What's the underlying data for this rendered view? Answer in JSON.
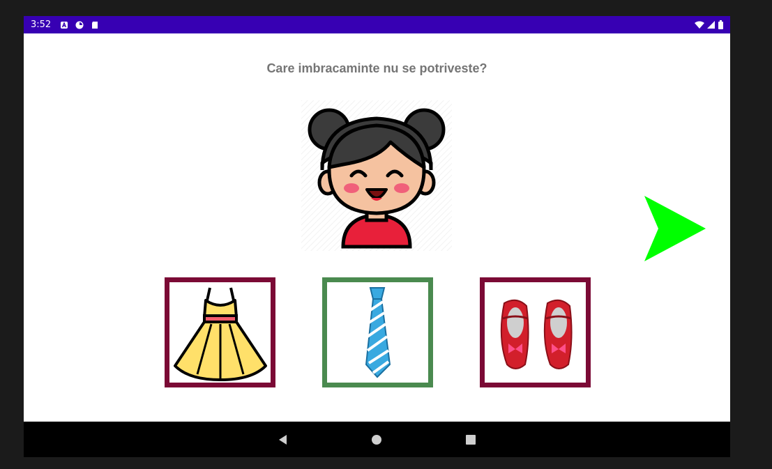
{
  "status_bar": {
    "time": "3:52",
    "left_icons": [
      "a-notification-icon",
      "data-usage-icon",
      "sd-card-icon"
    ],
    "right_icons": [
      "wifi-icon",
      "signal-icon",
      "battery-icon"
    ],
    "background": "#3700b3"
  },
  "quiz": {
    "question": "Care imbracaminte nu se potriveste?",
    "subject_image": "girl-avatar",
    "options": [
      {
        "icon": "dress-icon",
        "border_color": "#7b0a35",
        "state": "default"
      },
      {
        "icon": "tie-icon",
        "border_color": "#4a8a4f",
        "state": "selected"
      },
      {
        "icon": "shoes-icon",
        "border_color": "#7b0a35",
        "state": "default"
      }
    ],
    "next_button_color": "#00ff00"
  },
  "nav_bar": {
    "buttons": [
      "back-icon",
      "home-icon",
      "recents-icon"
    ]
  }
}
